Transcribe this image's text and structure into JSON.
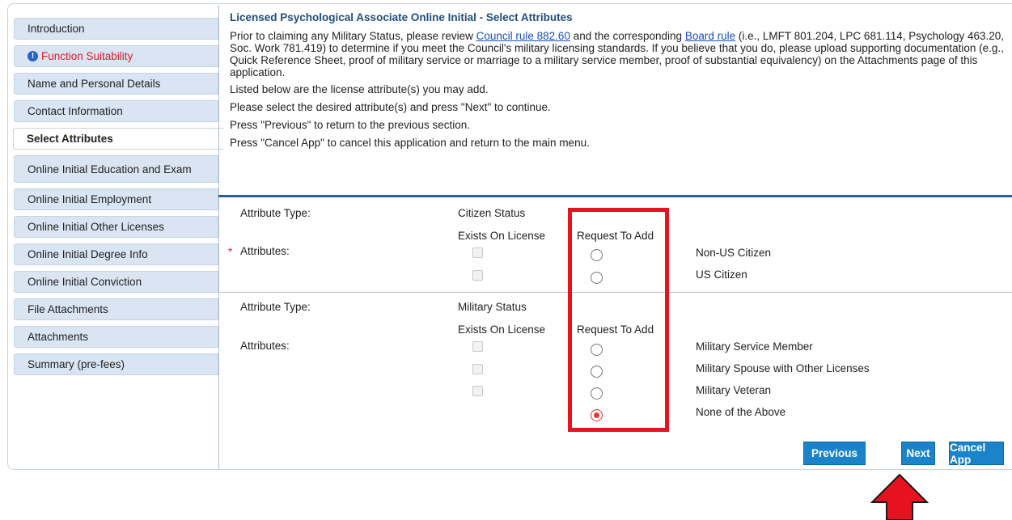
{
  "sidebar": {
    "items": [
      {
        "label": "Introduction"
      },
      {
        "label": "Function Suitability"
      },
      {
        "label": "Name and Personal Details"
      },
      {
        "label": "Contact Information"
      },
      {
        "label": "Select Attributes"
      },
      {
        "label": "Online Initial Education and Exam"
      },
      {
        "label": "Online Initial Employment"
      },
      {
        "label": "Online Initial Other Licenses"
      },
      {
        "label": "Online Initial Degree Info"
      },
      {
        "label": "Online Initial Conviction"
      },
      {
        "label": "File Attachments"
      },
      {
        "label": "Attachments"
      },
      {
        "label": "Summary (pre-fees)"
      }
    ]
  },
  "main": {
    "title": "Licensed Psychological Associate Online Initial - Select Attributes",
    "intro_1": "Prior to claiming any Military Status, please review ",
    "link_council": "Council rule 882.60",
    "intro_2": " and the corresponding ",
    "link_board": "Board rule",
    "intro_3": " (i.e., LMFT 801.204, LPC 681.114, Psychology 463.20, Soc. Work 781.419) to determine if you meet the Council's military licensing standards. If you believe that you do, please upload supporting documentation (e.g., Quick Reference Sheet, proof of military service or marriage to a military service member, proof of substantial equivalency) on the Attachments page of this application.",
    "line_listed": "Listed below are the license attribute(s) you may add.",
    "line_select": "Please select the desired attribute(s) and press \"Next\" to continue.",
    "line_previous": "Press \"Previous\" to return to the previous section.",
    "line_cancel": "Press \"Cancel App\" to cancel this application and return to the main menu."
  },
  "groups": [
    {
      "type_label": "Attribute Type:",
      "type_value": "Citizen Status",
      "col_exists": "Exists On License",
      "col_request": "Request To Add",
      "attributes_label": "Attributes:",
      "required": "*",
      "options": [
        {
          "label": "Non-US Citizen",
          "selected": false
        },
        {
          "label": "US Citizen",
          "selected": false
        }
      ]
    },
    {
      "type_label": "Attribute Type:",
      "type_value": "Military Status",
      "col_exists": "Exists On License",
      "col_request": "Request To Add",
      "attributes_label": "Attributes:",
      "options": [
        {
          "label": "Military Service Member",
          "selected": false
        },
        {
          "label": "Military Spouse with Other Licenses",
          "selected": false
        },
        {
          "label": "Military Veteran",
          "selected": false
        },
        {
          "label": "None of the Above",
          "selected": true
        }
      ]
    }
  ],
  "buttons": {
    "previous": "Previous",
    "next": "Next",
    "cancel": "Cancel App"
  },
  "colors": {
    "accent": "#1a83c9",
    "highlight": "#e6121d",
    "title": "#204d7f",
    "sidebar_bg": "#d9e5f3"
  },
  "icons": {
    "warning": "info-circle-icon",
    "pointer": "up-arrow-icon"
  }
}
